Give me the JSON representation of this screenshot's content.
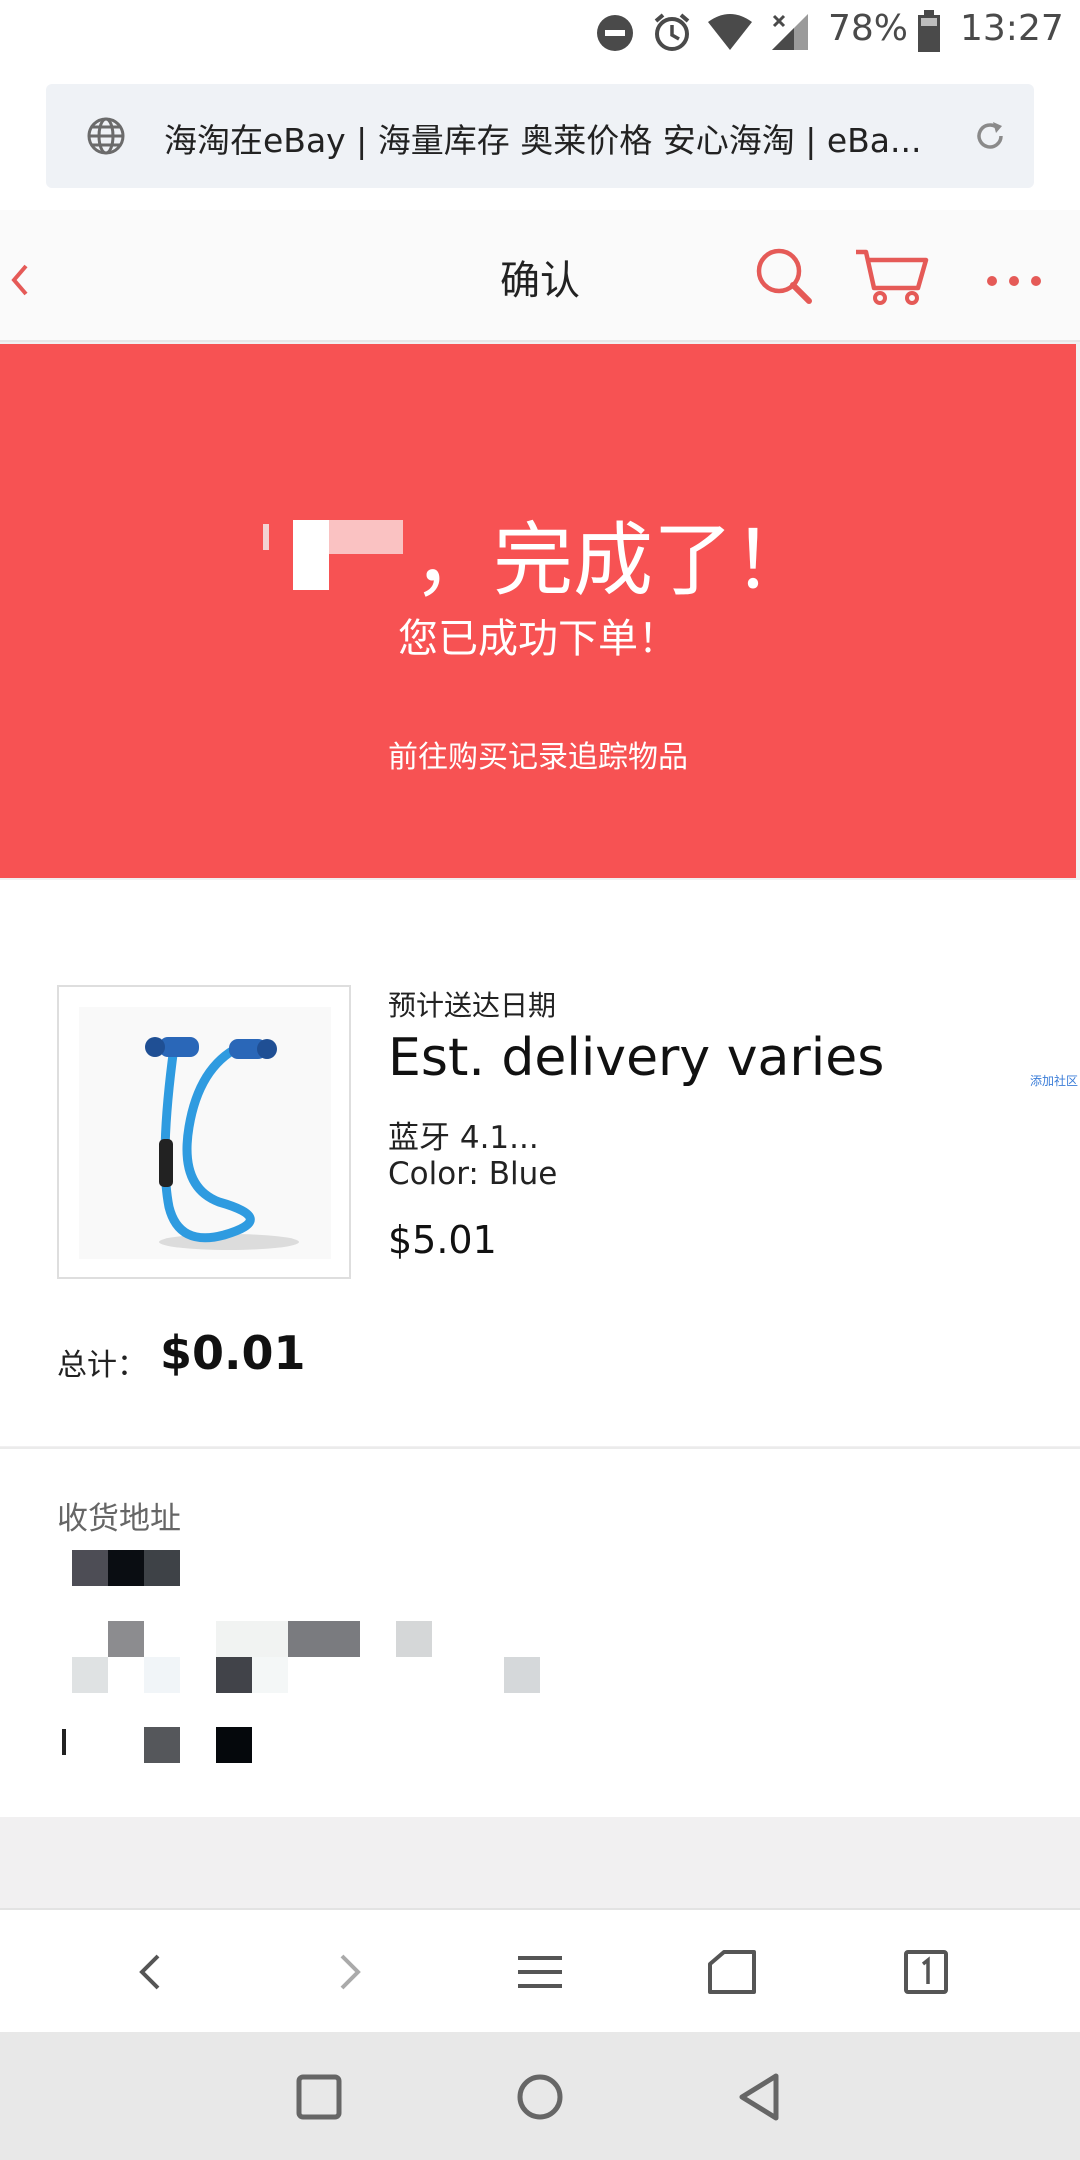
{
  "status_bar": {
    "battery": "78%",
    "time": "13:27"
  },
  "browser": {
    "url_title": "海淘在eBay | 海量库存 奥莱价格 安心海淘 | eBa..."
  },
  "header": {
    "title": "确认"
  },
  "banner": {
    "headline_suffix": "，完成了！",
    "subtitle": "您已成功下单！",
    "link_text": "前往购买记录追踪物品"
  },
  "item": {
    "est_label": "预计送达日期",
    "est_value": "Est. delivery varies",
    "name": "蓝牙 4.1...",
    "color": "Color: Blue",
    "price": "$5.01",
    "side_note": "添加社区"
  },
  "total": {
    "label": "总计：",
    "value": "$0.01"
  },
  "address": {
    "label": "收货地址"
  },
  "colors": {
    "accent": "#f75253",
    "icon_red": "#e55a57"
  },
  "icons": [
    "dnd-icon",
    "alarm-icon",
    "wifi-icon",
    "signal-icon",
    "battery-icon",
    "globe-icon",
    "reload-icon",
    "back-chevron-icon",
    "search-icon",
    "cart-icon",
    "more-icon"
  ]
}
